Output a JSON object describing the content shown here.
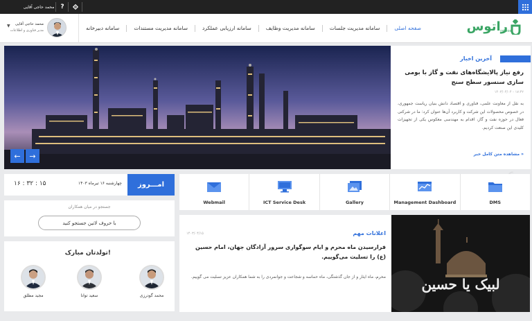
{
  "topbar": {
    "user_name": "محمد حاجی آقایی",
    "help_label": "?"
  },
  "header": {
    "logo_text": "راتوس",
    "logo_sub": "ratoos",
    "nav": [
      {
        "label": "صفحه اصلی",
        "active": true
      },
      {
        "label": "سامانه مدیریت جلسات",
        "active": false
      },
      {
        "label": "سامانه مدیریت وظایف",
        "active": false
      },
      {
        "label": "سامانه ارزیابی عملکرد",
        "active": false
      },
      {
        "label": "سامانه مدیریت مستندات",
        "active": false
      },
      {
        "label": "سامانه دبیرخانه",
        "active": false
      }
    ],
    "user": {
      "name": "محمد حاجی آقایی",
      "role": "مدیر فناوری و اطلاعات",
      "caret": "▼"
    }
  },
  "hero": {
    "prev": "←",
    "next": "→"
  },
  "news": {
    "label": "آخرین اخبار",
    "title": "رفع نیاز پالایشگاه‌های نفت و گاز با بومی سازی سنسور سطح سنج",
    "date": "۱۴۰۳/۰۴/۰۴ - ۱۷:۴۲",
    "body": "به نقل از معاونت علمی، فناوری و اقتصاد دانش بنیان ریاست جمهوری، در خصوص محصولات این شرکت و کاربرد آن‌ها عنوان کرد: ما در شرکتی فعال در حوزه نفت و گاز، اقدام به مهندسی معکوس یکی از تجهیزات کلیدی این صنعت کردیم.",
    "more": "مشاهده متن کامل خبر »"
  },
  "today": {
    "label": "امـــروز",
    "date": "چهارشنبه ۱۶ تیرماه ۱۴۰۳",
    "time": "۱۶ : ۳۲ : ۱۵"
  },
  "links": [
    {
      "label": "Webmail",
      "icon": "mail-icon"
    },
    {
      "label": "ICT Service Desk",
      "icon": "monitor-icon"
    },
    {
      "label": "Gallery",
      "icon": "gallery-icon"
    },
    {
      "label": "Management Dashboard",
      "icon": "dashboard-icon"
    },
    {
      "label": "DMS",
      "icon": "folder-icon"
    }
  ],
  "search": {
    "caption": "جستجو در میان همکاران",
    "button": "با حروف لاتین جستجو کنید"
  },
  "birthdays": {
    "title": "تولدتان مبارک!",
    "people": [
      {
        "name": "محمد گودرزی"
      },
      {
        "name": "سعید توانا"
      },
      {
        "name": "مجید مطلق"
      }
    ]
  },
  "announcement": {
    "label": "اعلانات مهم",
    "date": "۱۴۰۳/۰۴/۱۵",
    "title": "فرارسیدن ماه محرم و ایام سوگواری سرور آزادگان جهان، امام حسین (ع) را تسلیت می‌گوییم.",
    "body": "محرم، ماه ایثار و از جان گذشتگی، ماه حماسه و شجاعت و جوانمردی را به شما همکاران عزیز تسلیت می گوییم.",
    "image_text": "لبیک یا حسین"
  },
  "colors": {
    "accent": "#2f6fdb",
    "brand": "#3aa564",
    "topbar": "#222222"
  }
}
